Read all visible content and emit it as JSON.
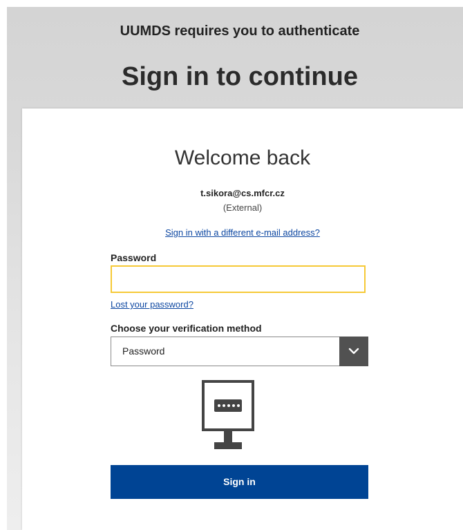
{
  "header": {
    "subtitle": "UUMDS requires you to authenticate",
    "title": "Sign in to continue"
  },
  "card": {
    "welcome": "Welcome back",
    "email": "t.sikora@cs.mfcr.cz",
    "account_type": "(External)",
    "different_email_link": "Sign in with a different e-mail address?",
    "password_label": "Password",
    "password_value": "",
    "lost_password_link": "Lost your password?",
    "method_label": "Choose your verification method",
    "method_selected": "Password",
    "method_icon": "monitor-password-icon",
    "signin_label": "Sign in"
  },
  "colors": {
    "accent": "#004494",
    "link": "#0d47a1",
    "focus_border": "#f6c935",
    "select_button": "#515151"
  }
}
